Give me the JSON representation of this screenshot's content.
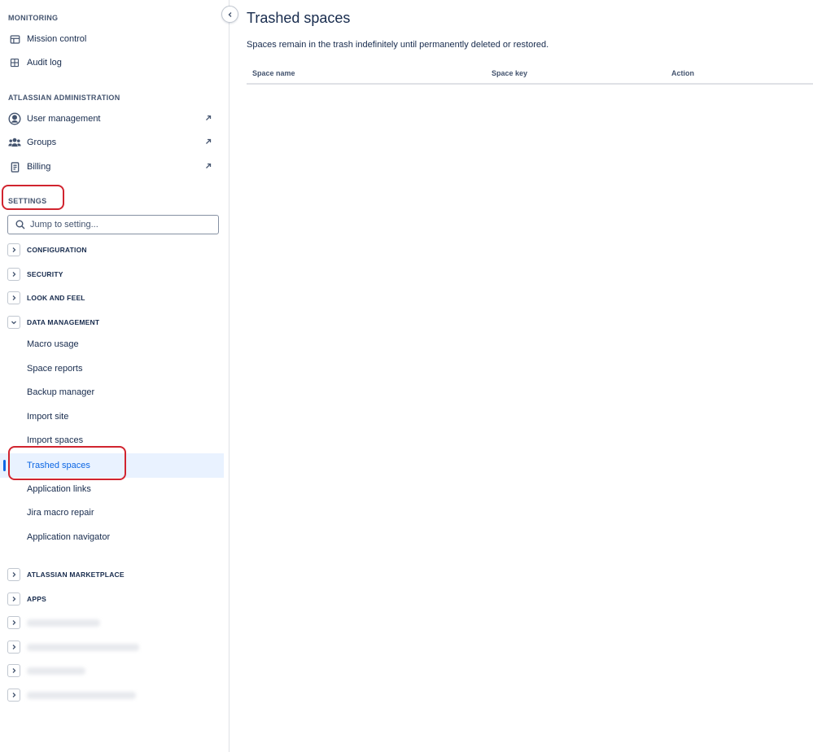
{
  "sidebar": {
    "monitoring": {
      "heading": "MONITORING",
      "items": [
        {
          "label": "Mission control",
          "icon": "dashboard-icon"
        },
        {
          "label": "Audit log",
          "icon": "table-grid-icon"
        }
      ]
    },
    "atlassian_admin": {
      "heading": "ATLASSIAN ADMINISTRATION",
      "items": [
        {
          "label": "User management",
          "icon": "person-circle-icon"
        },
        {
          "label": "Groups",
          "icon": "people-group-icon"
        },
        {
          "label": "Billing",
          "icon": "receipt-icon"
        }
      ]
    },
    "settings": {
      "heading": "SETTINGS",
      "search_placeholder": "Jump to setting...",
      "groups": [
        {
          "label": "CONFIGURATION",
          "expanded": false
        },
        {
          "label": "SECURITY",
          "expanded": false
        },
        {
          "label": "LOOK AND FEEL",
          "expanded": false
        },
        {
          "label": "DATA MANAGEMENT",
          "expanded": true
        }
      ],
      "data_management_items": [
        "Macro usage",
        "Space reports",
        "Backup manager",
        "Import site",
        "Import spaces",
        "Trashed spaces",
        "Application links",
        "Jira macro repair",
        "Application navigator"
      ],
      "active_item": "Trashed spaces",
      "more_groups": [
        {
          "label": "ATLASSIAN MARKETPLACE"
        },
        {
          "label": "APPS"
        }
      ]
    }
  },
  "main": {
    "title": "Trashed spaces",
    "description": "Spaces remain in the trash indefinitely until permanently deleted or restored.",
    "table": {
      "columns": [
        "Space name",
        "Space key",
        "Action"
      ],
      "rows": []
    }
  },
  "colors": {
    "active_text": "#0c66e4",
    "active_bg": "#e9f2ff",
    "highlight_ring": "#d1242f"
  }
}
